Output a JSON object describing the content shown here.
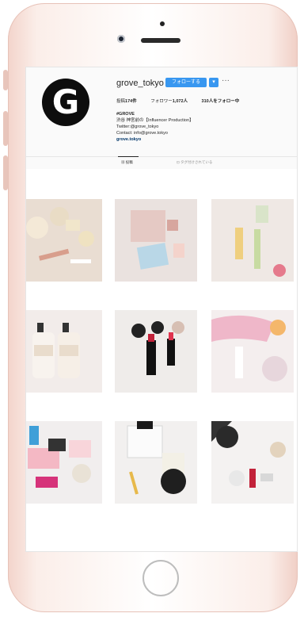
{
  "profile": {
    "username": "grove_tokyo",
    "follow_label": "フォローする",
    "menu_glyph": "▾",
    "more_glyph": "···",
    "avatar_letter": "G",
    "stats": {
      "posts_label": "投稿",
      "posts_value": "174件",
      "followers_label": "フォロワー",
      "followers_value": "1,072人",
      "following_value": "310人をフォロー中"
    },
    "bio": {
      "title": "#GROVE",
      "line1": "渋谷 神宮前の【Influencer Production】",
      "line2": "Twitter:@grove_tokyo",
      "line3": "Contact: info@grove.tokyo",
      "website": "grove.tokyo"
    }
  },
  "tabs": [
    {
      "label": "▦ 投稿"
    },
    {
      "label": "⊡ タグ付けされている"
    }
  ],
  "photos": [
    {
      "name": "photo-cushion-compacts"
    },
    {
      "name": "photo-eyeshadow-palette"
    },
    {
      "name": "photo-serum-bottles"
    },
    {
      "name": "photo-hair-care-bottles"
    },
    {
      "name": "photo-chanel-lipsticks"
    },
    {
      "name": "photo-pink-pouch-perfume"
    },
    {
      "name": "photo-highlighter-palettes"
    },
    {
      "name": "photo-jo-malone-candles"
    },
    {
      "name": "photo-makeup-pieces"
    }
  ],
  "colors": {
    "follow_blue": "#3897f0",
    "phone_rose": "#f3d4cb",
    "link_blue": "#003569"
  }
}
